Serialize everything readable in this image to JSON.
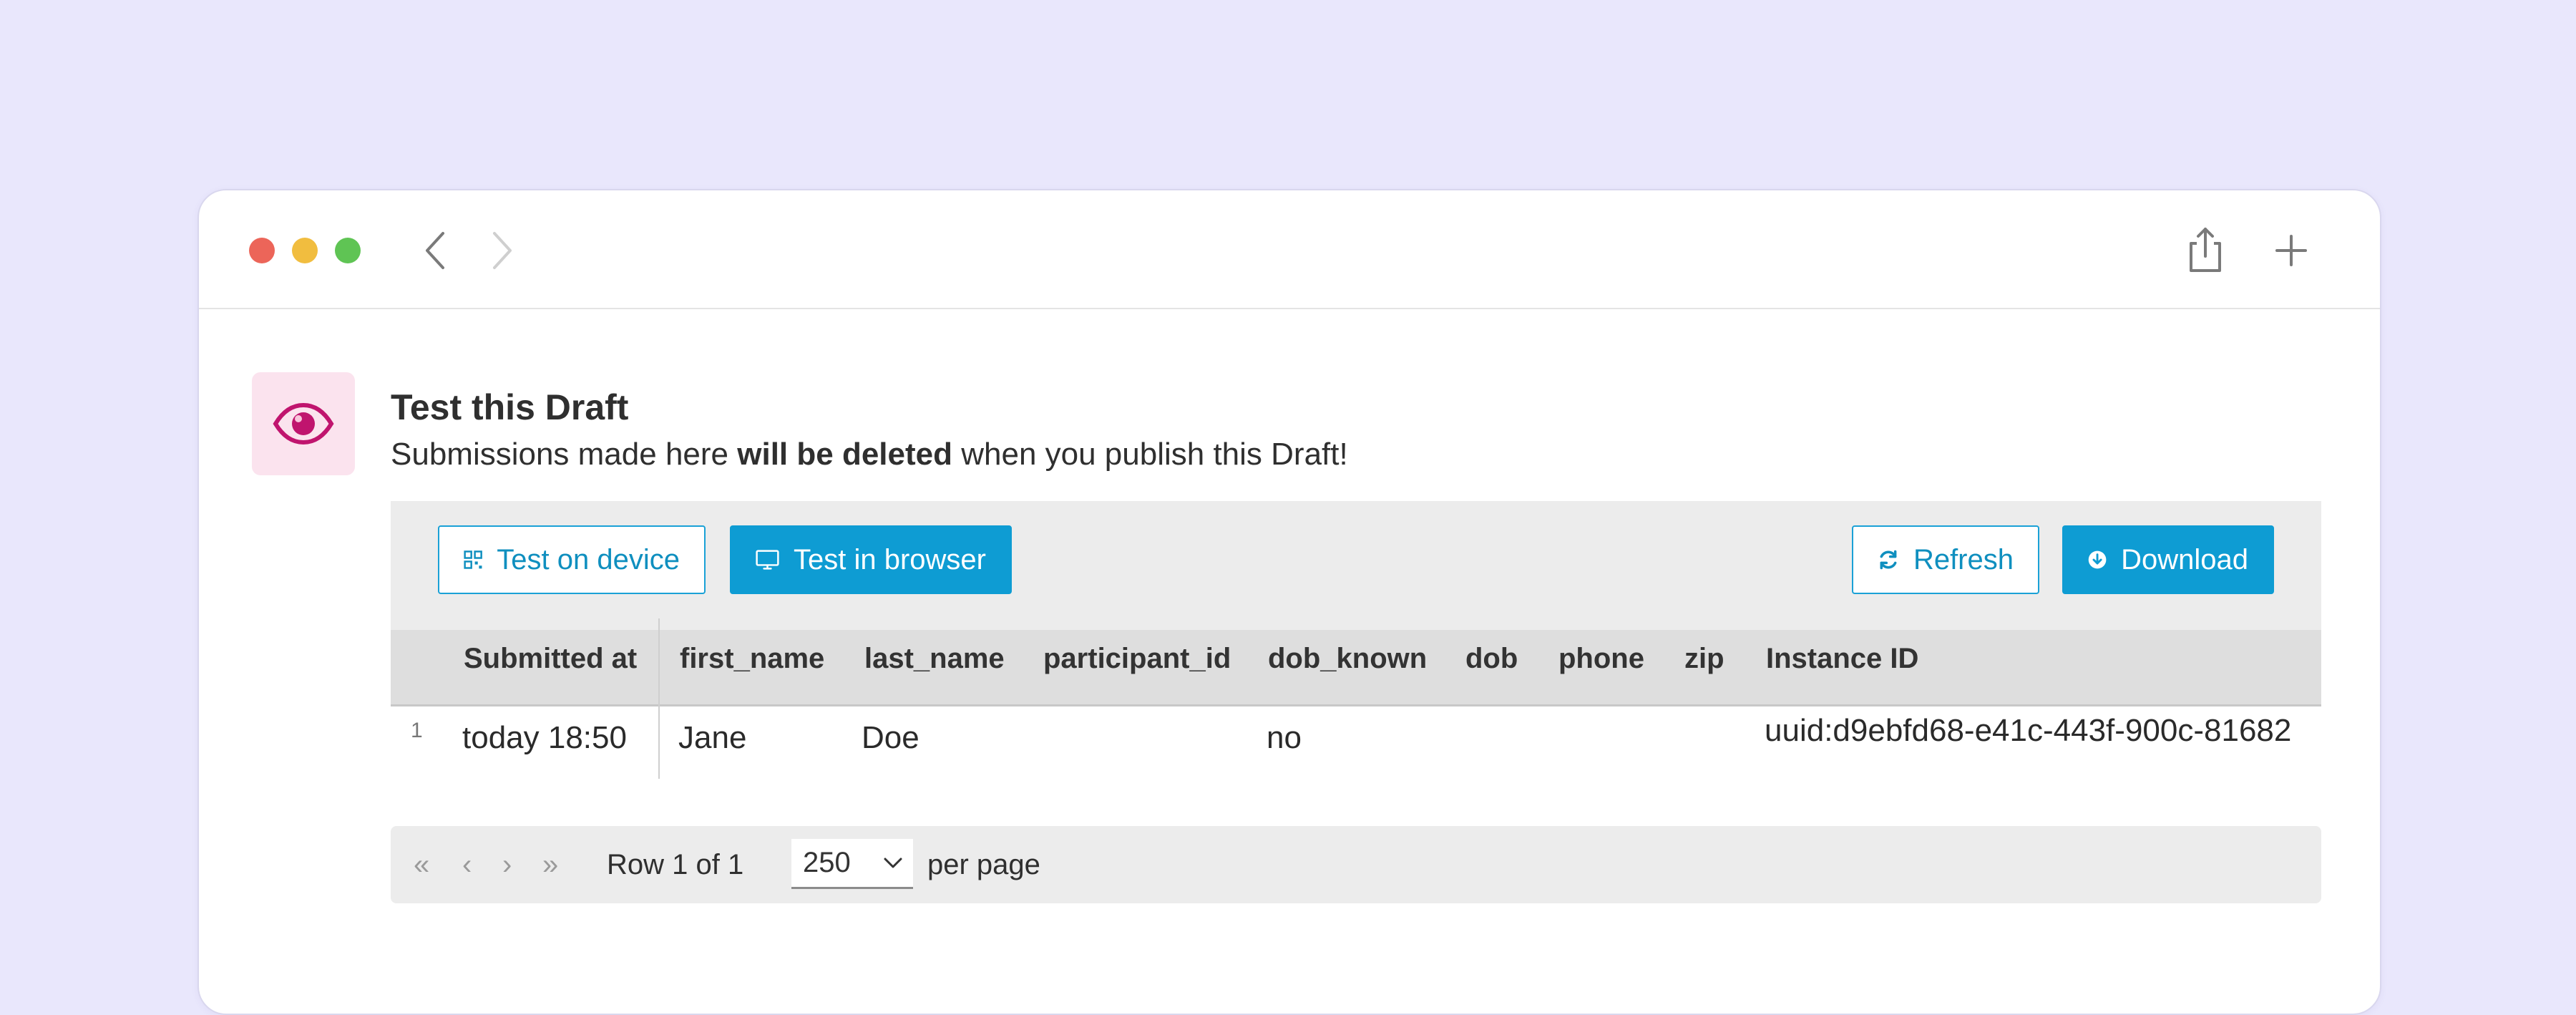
{
  "browser": {
    "back_icon": "chevron-left-icon",
    "forward_icon": "chevron-right-icon",
    "share_icon": "share-icon",
    "new_tab_icon": "plus-icon"
  },
  "header": {
    "icon": "eye-icon",
    "title": "Test this Draft",
    "subtitle_pre": "Submissions made here ",
    "subtitle_bold": "will be deleted",
    "subtitle_post": " when you publish this Draft!"
  },
  "toolbar": {
    "test_device_label": "Test on device",
    "test_browser_label": "Test in browser",
    "refresh_label": "Refresh",
    "download_label": "Download"
  },
  "table": {
    "columns": [
      "Submitted at",
      "first_name",
      "last_name",
      "participant_id",
      "dob_known",
      "dob",
      "phone",
      "zip",
      "Instance ID"
    ],
    "rows": [
      {
        "row_number": "1",
        "cells": [
          "today 18:50",
          "Jane",
          "Doe",
          "",
          "no",
          "",
          "",
          "",
          "uuid:d9ebfd68-e41c-443f-900c-81682"
        ]
      }
    ]
  },
  "pagination": {
    "row_info": "Row 1 of 1",
    "page_size": "250",
    "per_page_label": "per page"
  },
  "colors": {
    "accent": "#0e9cd3",
    "eye": "#c0146e",
    "background": "#e9e7fc"
  }
}
